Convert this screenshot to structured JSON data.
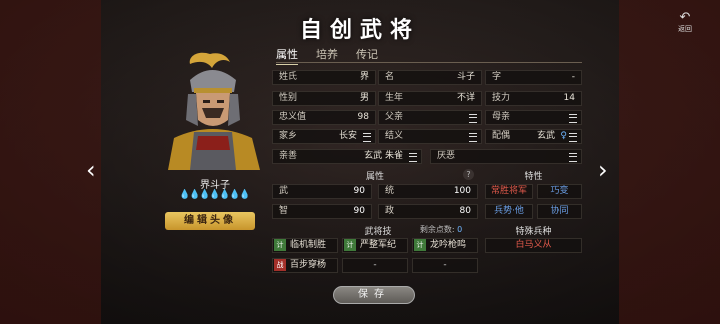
{
  "header": {
    "title": "自创武将",
    "return_label": "返回"
  },
  "tabs": [
    {
      "label": "属性",
      "active": true
    },
    {
      "label": "培养",
      "active": false
    },
    {
      "label": "传记",
      "active": false
    }
  ],
  "hero": {
    "name": "界斗子",
    "drop_count": 7,
    "edit_label": "编辑头像"
  },
  "profile": {
    "surname": {
      "label": "姓氏",
      "value": "界"
    },
    "given": {
      "label": "名",
      "value": "斗子"
    },
    "zi": {
      "label": "字",
      "value": "-"
    },
    "gender": {
      "label": "性别",
      "value": "男"
    },
    "birth": {
      "label": "生年",
      "value": "不详"
    },
    "skill_power": {
      "label": "技力",
      "value": "14"
    },
    "loyalty": {
      "label": "忠义值",
      "value": "98"
    },
    "father": {
      "label": "父亲"
    },
    "mother": {
      "label": "母亲"
    },
    "hometown": {
      "label": "家乡",
      "value": "长安"
    },
    "sworn": {
      "label": "结义"
    },
    "spouse": {
      "label": "配偶",
      "value": "玄武"
    },
    "like": {
      "label": "亲善",
      "value": "玄武 朱雀"
    },
    "dislike": {
      "label": "厌恶"
    }
  },
  "attributes": {
    "heading": "属性",
    "help": "?",
    "items": [
      {
        "label": "武",
        "value": "90"
      },
      {
        "label": "统",
        "value": "100"
      },
      {
        "label": "智",
        "value": "90"
      },
      {
        "label": "政",
        "value": "80"
      }
    ]
  },
  "traits": {
    "heading": "特性",
    "items": [
      {
        "label": "常胜将军",
        "color": "#e25a4c"
      },
      {
        "label": "巧变",
        "color": "#6b9fe6"
      },
      {
        "label": "兵势·他",
        "color": "#6b9fe6"
      },
      {
        "label": "协同",
        "color": "#6b9fe6"
      }
    ]
  },
  "skills": {
    "heading": "武将技",
    "remain_label": "剩余点数:",
    "remain_value": "0",
    "items": [
      {
        "tag": "计",
        "name": "临机制胜"
      },
      {
        "tag": "计",
        "name": "严整军纪"
      },
      {
        "tag": "计",
        "name": "龙吟枪鸣"
      },
      {
        "tag": "战",
        "name": "百步穿杨"
      },
      {
        "name": "-"
      },
      {
        "name": "-"
      }
    ]
  },
  "special_troop": {
    "heading": "特殊兵种",
    "value": "白马义从"
  },
  "footer": {
    "save_label": "保存"
  },
  "colors": {
    "accent_gold": "#d9a43f",
    "trait_red": "#e25a4c",
    "trait_blue": "#6b9fe6",
    "skill_green": "#3f7a3a",
    "battle_red": "#a3302a"
  }
}
